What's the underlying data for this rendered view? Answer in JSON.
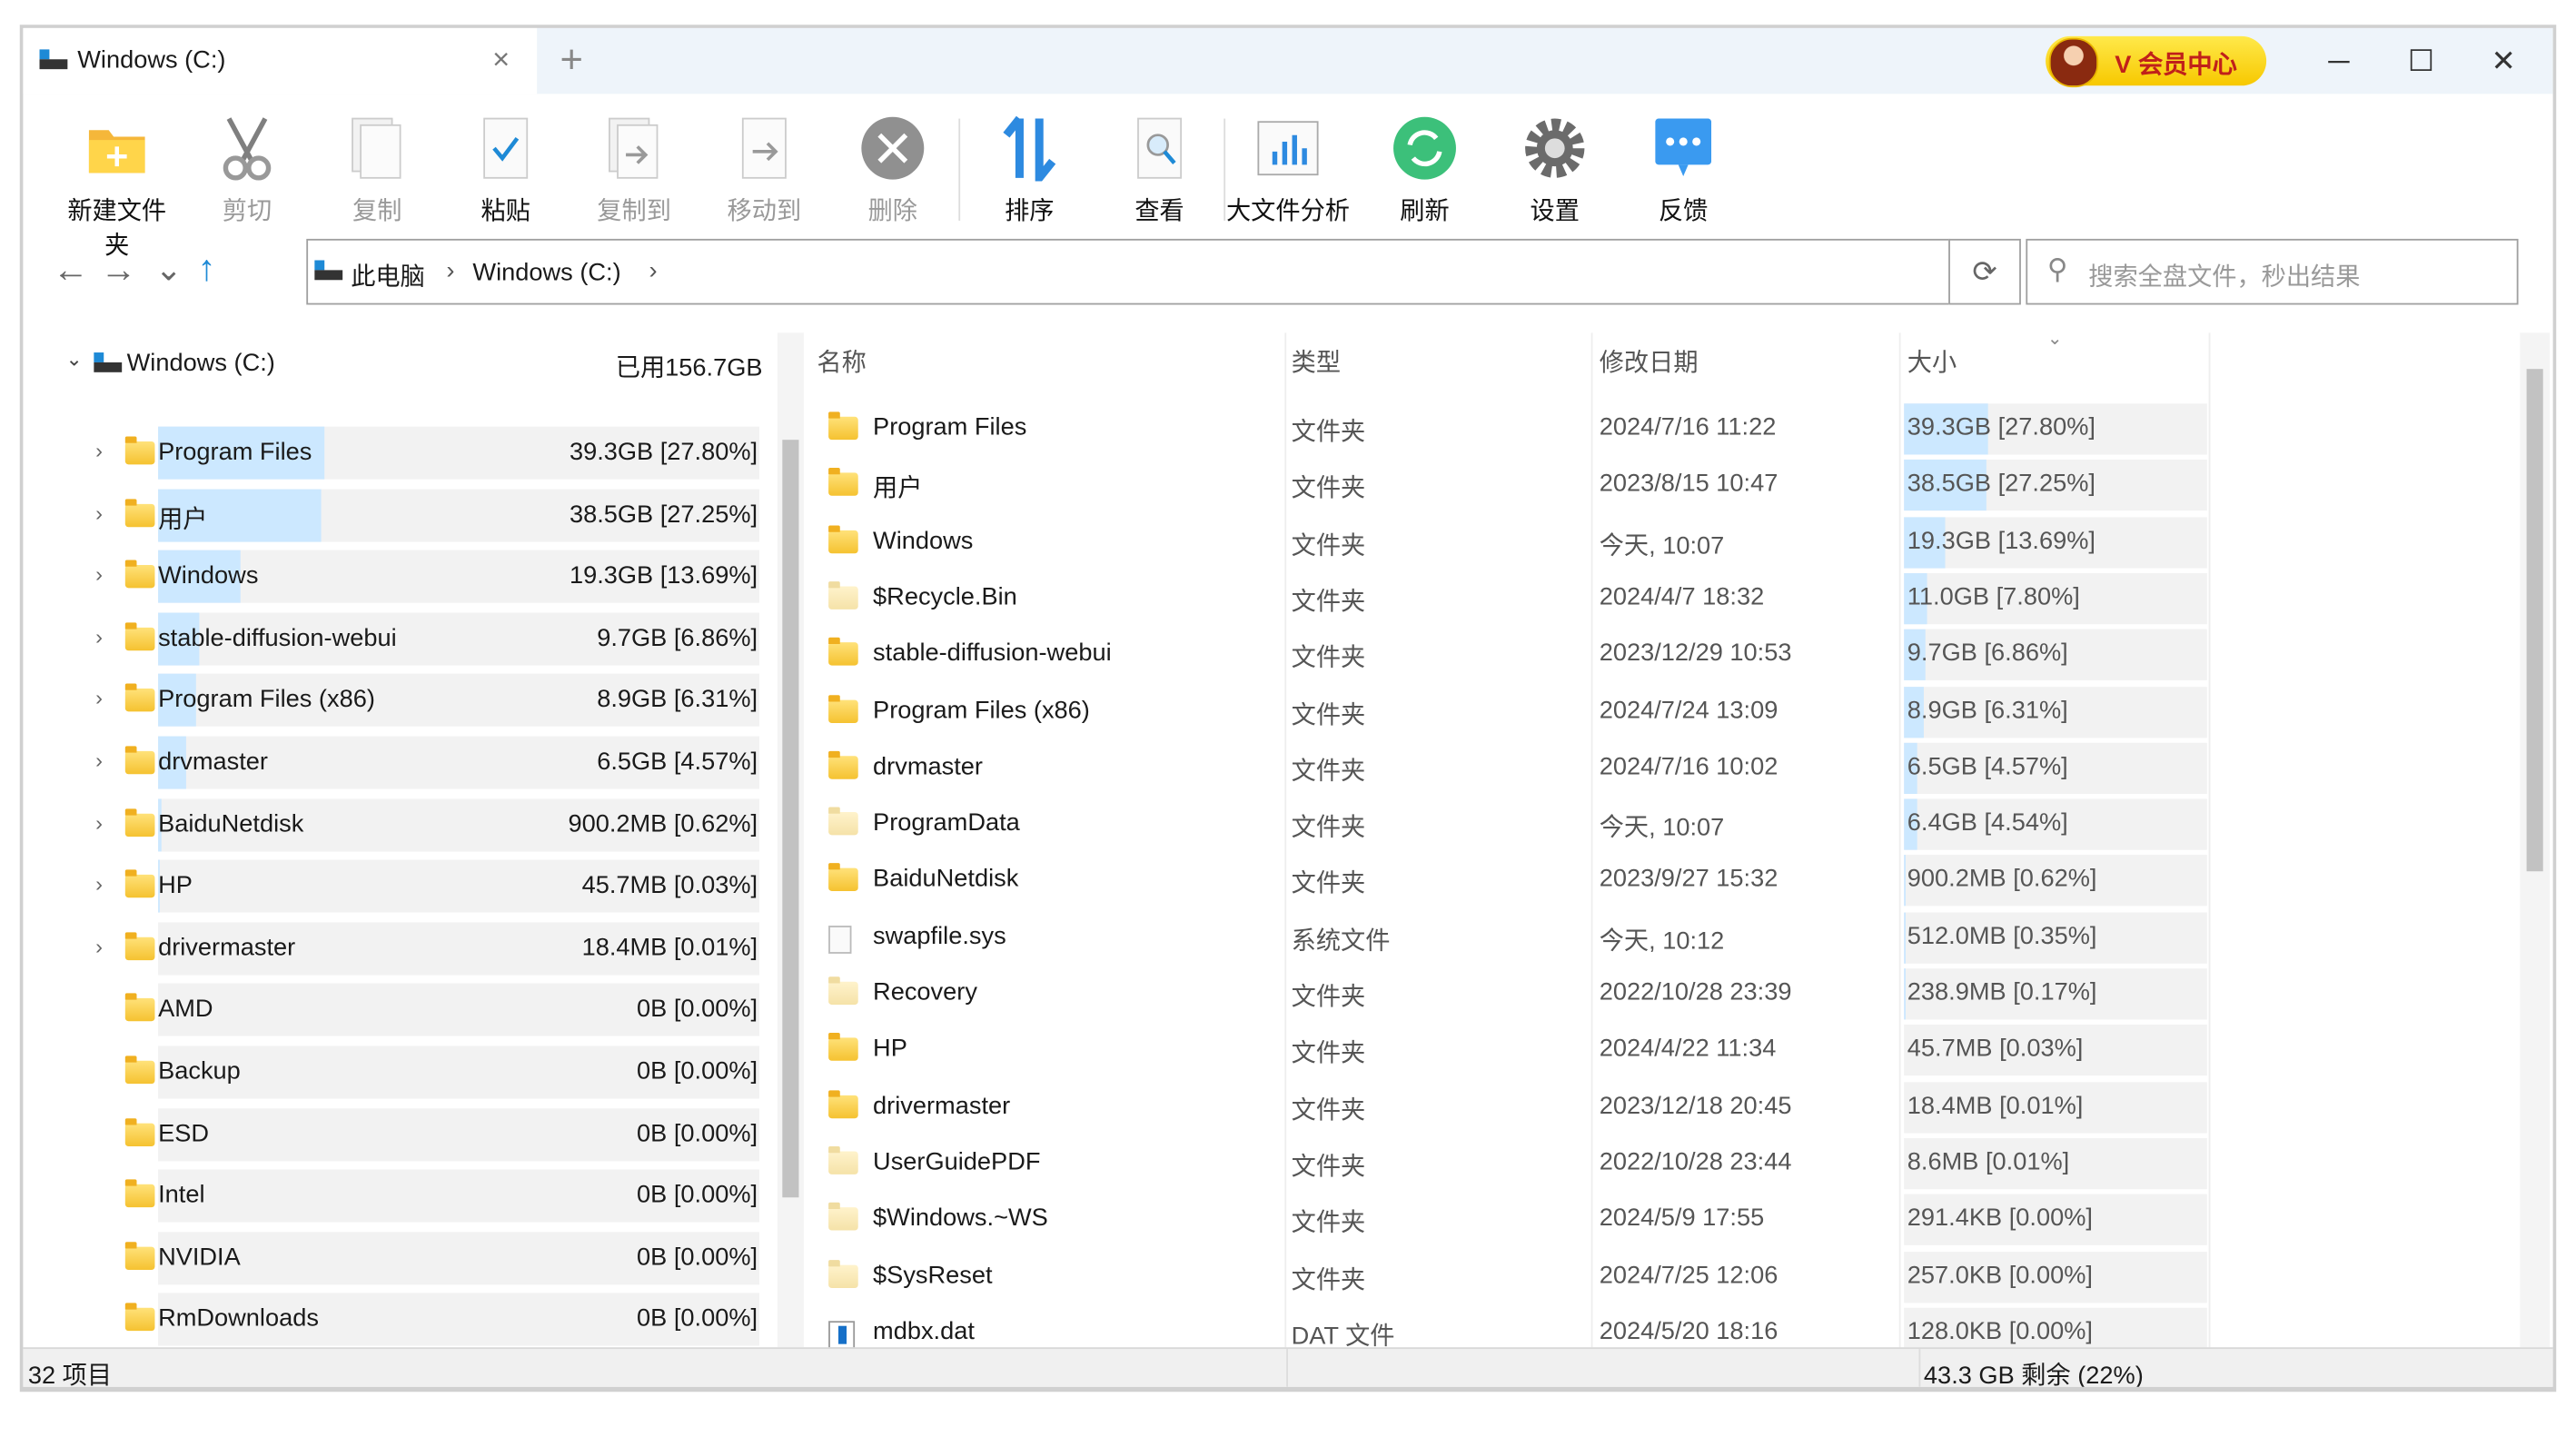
{
  "tab": {
    "title": "Windows (C:)",
    "close": "×",
    "new_tab": "+"
  },
  "vip": {
    "label": "V 会员中心"
  },
  "window_controls": {
    "minimize": "─",
    "maximize": "☐",
    "close": "✕"
  },
  "toolbar": [
    {
      "id": "new-folder",
      "label": "新建文件夹",
      "icon": "new-folder-icon",
      "enabled": true
    },
    {
      "id": "cut",
      "label": "剪切",
      "icon": "scissors-icon",
      "enabled": false
    },
    {
      "id": "copy",
      "label": "复制",
      "icon": "copy-icon",
      "enabled": false
    },
    {
      "id": "paste",
      "label": "粘贴",
      "icon": "paste-icon",
      "enabled": true
    },
    {
      "id": "copy-to",
      "label": "复制到",
      "icon": "copy-to-icon",
      "enabled": false
    },
    {
      "id": "move-to",
      "label": "移动到",
      "icon": "move-to-icon",
      "enabled": false
    },
    {
      "id": "delete",
      "label": "删除",
      "icon": "delete-icon",
      "enabled": false
    },
    {
      "id": "sort",
      "label": "排序",
      "icon": "sort-icon",
      "enabled": true
    },
    {
      "id": "view",
      "label": "查看",
      "icon": "view-icon",
      "enabled": true
    },
    {
      "id": "large-file-analysis",
      "label": "大文件分析",
      "icon": "chart-icon",
      "enabled": true
    },
    {
      "id": "refresh",
      "label": "刷新",
      "icon": "refresh-icon",
      "enabled": true
    },
    {
      "id": "settings",
      "label": "设置",
      "icon": "gear-icon",
      "enabled": true
    },
    {
      "id": "feedback",
      "label": "反馈",
      "icon": "chat-icon",
      "enabled": true
    }
  ],
  "nav": {
    "back": "←",
    "forward": "→",
    "history": "⌄",
    "up": "↑"
  },
  "breadcrumb": [
    "此电脑",
    "Windows (C:)"
  ],
  "search": {
    "placeholder": "搜索全盘文件，秒出结果"
  },
  "tree": {
    "root": {
      "name": "Windows (C:)",
      "used": "已用156.7GB"
    },
    "items": [
      {
        "name": "Program Files",
        "size": "39.3GB [27.80%]",
        "pct": 27.8,
        "expandable": true
      },
      {
        "name": "用户",
        "size": "38.5GB [27.25%]",
        "pct": 27.25,
        "expandable": true
      },
      {
        "name": "Windows",
        "size": "19.3GB [13.69%]",
        "pct": 13.69,
        "expandable": true
      },
      {
        "name": "stable-diffusion-webui",
        "size": "9.7GB [6.86%]",
        "pct": 6.86,
        "expandable": true
      },
      {
        "name": "Program Files (x86)",
        "size": "8.9GB [6.31%]",
        "pct": 6.31,
        "expandable": true
      },
      {
        "name": "drvmaster",
        "size": "6.5GB [4.57%]",
        "pct": 4.57,
        "expandable": true
      },
      {
        "name": "BaiduNetdisk",
        "size": "900.2MB [0.62%]",
        "pct": 0.62,
        "expandable": true
      },
      {
        "name": "HP",
        "size": "45.7MB [0.03%]",
        "pct": 0.03,
        "expandable": true
      },
      {
        "name": "drivermaster",
        "size": "18.4MB [0.01%]",
        "pct": 0.01,
        "expandable": true
      },
      {
        "name": "AMD",
        "size": "0B [0.00%]",
        "pct": 0,
        "expandable": false
      },
      {
        "name": "Backup",
        "size": "0B [0.00%]",
        "pct": 0,
        "expandable": false
      },
      {
        "name": "ESD",
        "size": "0B [0.00%]",
        "pct": 0,
        "expandable": false
      },
      {
        "name": "Intel",
        "size": "0B [0.00%]",
        "pct": 0,
        "expandable": false
      },
      {
        "name": "NVIDIA",
        "size": "0B [0.00%]",
        "pct": 0,
        "expandable": false
      },
      {
        "name": "RmDownloads",
        "size": "0B [0.00%]",
        "pct": 0,
        "expandable": false
      }
    ]
  },
  "list": {
    "columns": {
      "name": "名称",
      "type": "类型",
      "date": "修改日期",
      "size": "大小"
    },
    "rows": [
      {
        "name": "Program Files",
        "type": "文件夹",
        "date": "2024/7/16 11:22",
        "size": "39.3GB [27.80%]",
        "pct": 27.8,
        "icon": "folder"
      },
      {
        "name": "用户",
        "type": "文件夹",
        "date": "2023/8/15 10:47",
        "size": "38.5GB [27.25%]",
        "pct": 27.25,
        "icon": "folder"
      },
      {
        "name": "Windows",
        "type": "文件夹",
        "date": "今天, 10:07",
        "size": "19.3GB [13.69%]",
        "pct": 13.69,
        "icon": "folder"
      },
      {
        "name": "$Recycle.Bin",
        "type": "文件夹",
        "date": "2024/4/7 18:32",
        "size": "11.0GB [7.80%]",
        "pct": 7.8,
        "icon": "folder-hidden"
      },
      {
        "name": "stable-diffusion-webui",
        "type": "文件夹",
        "date": "2023/12/29 10:53",
        "size": "9.7GB [6.86%]",
        "pct": 6.86,
        "icon": "folder"
      },
      {
        "name": "Program Files (x86)",
        "type": "文件夹",
        "date": "2024/7/24 13:09",
        "size": "8.9GB [6.31%]",
        "pct": 6.31,
        "icon": "folder"
      },
      {
        "name": "drvmaster",
        "type": "文件夹",
        "date": "2024/7/16 10:02",
        "size": "6.5GB [4.57%]",
        "pct": 4.57,
        "icon": "folder"
      },
      {
        "name": "ProgramData",
        "type": "文件夹",
        "date": "今天, 10:07",
        "size": "6.4GB [4.54%]",
        "pct": 4.54,
        "icon": "folder-hidden"
      },
      {
        "name": "BaiduNetdisk",
        "type": "文件夹",
        "date": "2023/9/27 15:32",
        "size": "900.2MB [0.62%]",
        "pct": 0.62,
        "icon": "folder"
      },
      {
        "name": "swapfile.sys",
        "type": "系统文件",
        "date": "今天, 10:12",
        "size": "512.0MB [0.35%]",
        "pct": 0.35,
        "icon": "file"
      },
      {
        "name": "Recovery",
        "type": "文件夹",
        "date": "2022/10/28 23:39",
        "size": "238.9MB [0.17%]",
        "pct": 0.17,
        "icon": "folder-hidden"
      },
      {
        "name": "HP",
        "type": "文件夹",
        "date": "2024/4/22 11:34",
        "size": "45.7MB [0.03%]",
        "pct": 0.03,
        "icon": "folder"
      },
      {
        "name": "drivermaster",
        "type": "文件夹",
        "date": "2023/12/18 20:45",
        "size": "18.4MB [0.01%]",
        "pct": 0.01,
        "icon": "folder"
      },
      {
        "name": "UserGuidePDF",
        "type": "文件夹",
        "date": "2022/10/28 23:44",
        "size": "8.6MB [0.01%]",
        "pct": 0.01,
        "icon": "folder-hidden"
      },
      {
        "name": "$Windows.~WS",
        "type": "文件夹",
        "date": "2024/5/9 17:55",
        "size": "291.4KB [0.00%]",
        "pct": 0,
        "icon": "folder-hidden"
      },
      {
        "name": "$SysReset",
        "type": "文件夹",
        "date": "2024/7/25 12:06",
        "size": "257.0KB [0.00%]",
        "pct": 0,
        "icon": "folder-hidden"
      },
      {
        "name": "mdbx.dat",
        "type": "DAT 文件",
        "date": "2024/5/20 18:16",
        "size": "128.0KB [0.00%]",
        "pct": 0,
        "icon": "dat-file"
      }
    ]
  },
  "status": {
    "items": "32 项目",
    "free": "43.3 GB 剩余 (22%)"
  },
  "colors": {
    "accent": "#1e8ad6",
    "size_bar": "#cce8ff",
    "row_bg": "#f2f2f2",
    "tab_bar": "#eef4fa"
  }
}
